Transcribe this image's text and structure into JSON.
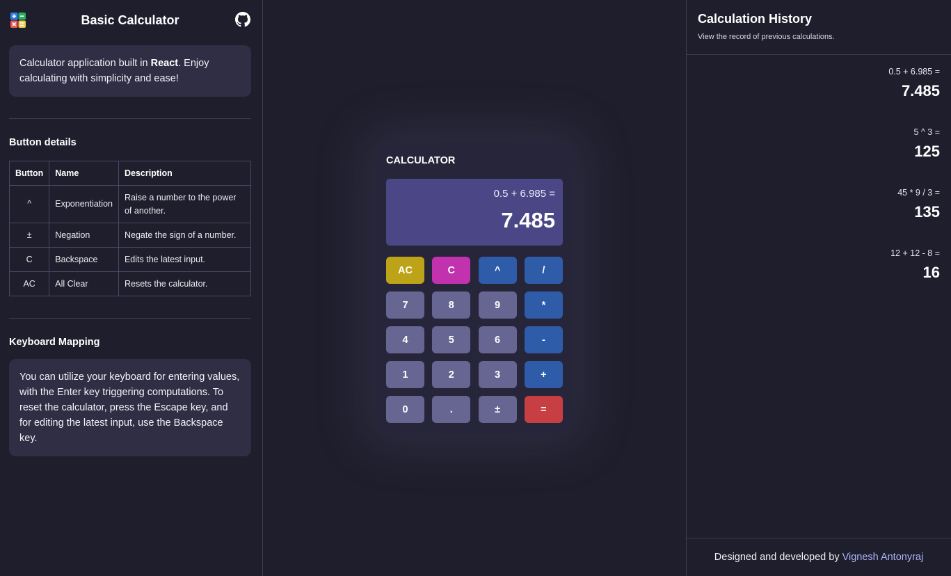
{
  "app": {
    "title": "Basic Calculator",
    "logo_icon": "calculator-app-icon",
    "repo_icon": "github-icon"
  },
  "intro": {
    "text_before": "Calculator application built in ",
    "text_bold": "React",
    "text_after": ". Enjoy calculating with simplicity and ease!"
  },
  "button_details": {
    "title": "Button details",
    "headers": [
      "Button",
      "Name",
      "Description"
    ],
    "rows": [
      {
        "button": "^",
        "name": "Exponentiation",
        "description": "Raise a number to the power of another."
      },
      {
        "button": "±",
        "name": "Negation",
        "description": "Negate the sign of a number."
      },
      {
        "button": "C",
        "name": "Backspace",
        "description": "Edits the latest input."
      },
      {
        "button": "AC",
        "name": "All Clear",
        "description": "Resets the calculator."
      }
    ]
  },
  "keyboard": {
    "title": "Keyboard Mapping",
    "text": "You can utilize your keyboard for entering values, with the Enter key triggering computations. To reset the calculator, press the Escape key, and for editing the latest input, use the Backspace key."
  },
  "calculator": {
    "title": "CALCULATOR",
    "expression": "0.5 + 6.985 =",
    "result": "7.485",
    "keys": [
      [
        "AC",
        "C",
        "^",
        "/"
      ],
      [
        "7",
        "8",
        "9",
        "*"
      ],
      [
        "4",
        "5",
        "6",
        "-"
      ],
      [
        "1",
        "2",
        "3",
        "+"
      ],
      [
        "0",
        ".",
        "±",
        "="
      ]
    ],
    "colors": {
      "ac": "#bda317",
      "c": "#c231ae",
      "operator": "#2f5ca8",
      "equals": "#c73e43",
      "digit": "#676591",
      "display": "#4b4686"
    }
  },
  "history": {
    "title": "Calculation History",
    "subtitle": "View the record of previous calculations.",
    "items": [
      {
        "expression": "0.5 + 6.985 =",
        "result": "7.485"
      },
      {
        "expression": "5 ^ 3 =",
        "result": "125"
      },
      {
        "expression": "45 * 9 / 3 =",
        "result": "135"
      },
      {
        "expression": "12 + 12 - 8 =",
        "result": "16"
      }
    ]
  },
  "footer": {
    "text": "Designed and developed by",
    "author": "Vignesh Antonyraj"
  }
}
